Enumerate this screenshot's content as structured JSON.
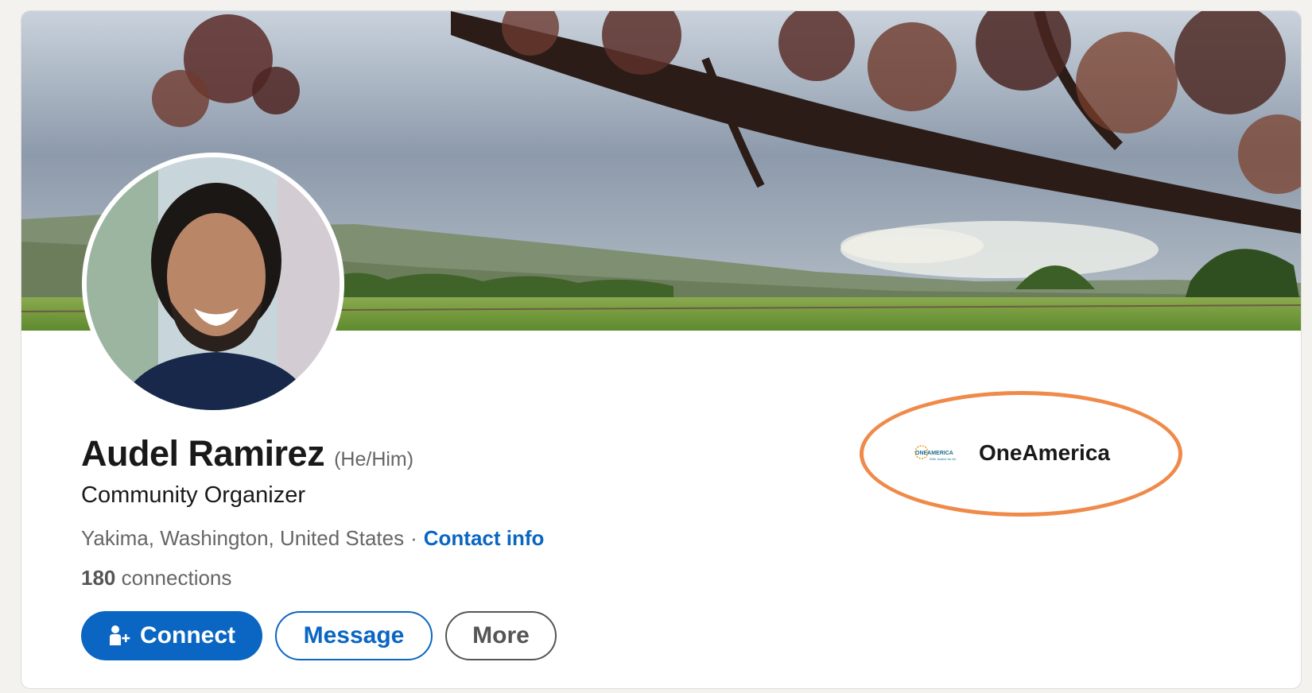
{
  "profile": {
    "name": "Audel Ramirez",
    "pronouns": "(He/Him)",
    "headline": "Community Organizer",
    "location": "Yakima, Washington, United States",
    "separator": "·",
    "contact_info_label": "Contact info",
    "connections_count": "180",
    "connections_label": "connections"
  },
  "actions": {
    "connect_label": "Connect",
    "message_label": "Message",
    "more_label": "More"
  },
  "organization": {
    "name": "OneAmerica",
    "logo_text": "ONEAMERICA",
    "logo_tagline": "With Justice for All"
  },
  "icons": {
    "connect": "person-add-icon"
  },
  "colors": {
    "primary": "#0a66c2",
    "highlight_ring": "#ef8a4a",
    "text_primary": "#191919",
    "text_secondary": "#666666"
  }
}
